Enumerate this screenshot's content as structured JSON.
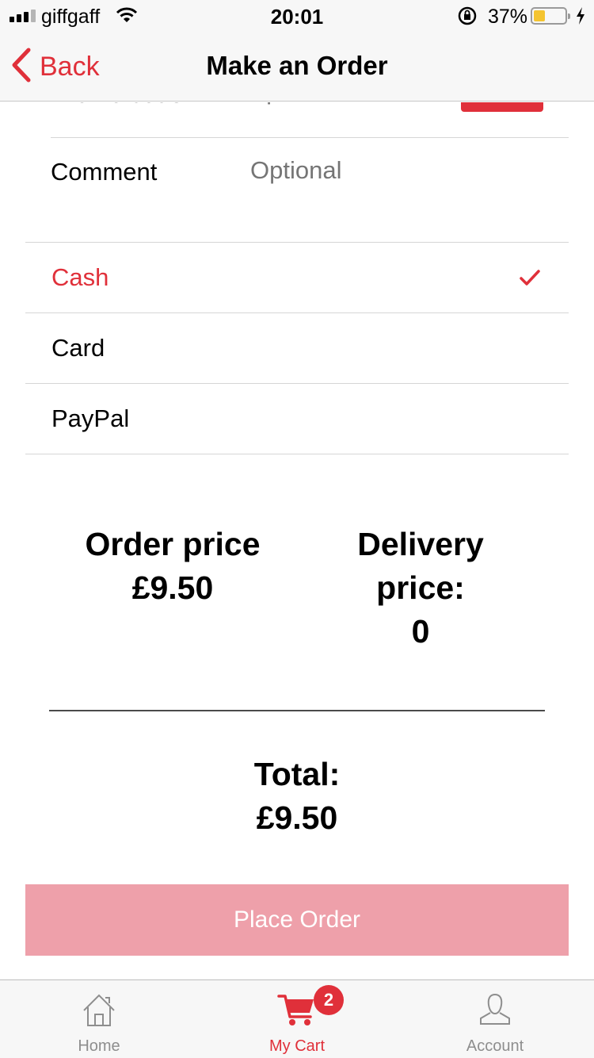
{
  "status_bar": {
    "carrier": "giffgaff",
    "time": "20:01",
    "battery_percent": "37%",
    "battery_level": 0.37,
    "signal_bars_filled": 3,
    "signal_bars_total": 4
  },
  "nav": {
    "back_label": "Back",
    "title": "Make an Order"
  },
  "form": {
    "promo": {
      "label": "Promo code",
      "placeholder": "Optional",
      "check_label": "Check"
    },
    "comment": {
      "label": "Comment",
      "placeholder": "Optional"
    }
  },
  "payment_methods": [
    {
      "label": "Cash",
      "selected": true
    },
    {
      "label": "Card",
      "selected": false
    },
    {
      "label": "PayPal",
      "selected": false
    }
  ],
  "summary": {
    "order_price_label": "Order price",
    "order_price_value": "£9.50",
    "delivery_label_line1": "Delivery",
    "delivery_label_line2": "price:",
    "delivery_value": "0",
    "total_label": "Total:",
    "total_value": "£9.50"
  },
  "place_order_label": "Place Order",
  "tabs": [
    {
      "label": "Home",
      "icon": "home-icon",
      "active": false
    },
    {
      "label": "My Cart",
      "icon": "cart-icon",
      "active": true,
      "badge": "2"
    },
    {
      "label": "Account",
      "icon": "account-icon",
      "active": false
    }
  ],
  "colors": {
    "accent": "#e0303a",
    "button_disabled": "#eea0aa",
    "bar_background": "#f7f7f7",
    "placeholder": "#b0b0b0"
  }
}
